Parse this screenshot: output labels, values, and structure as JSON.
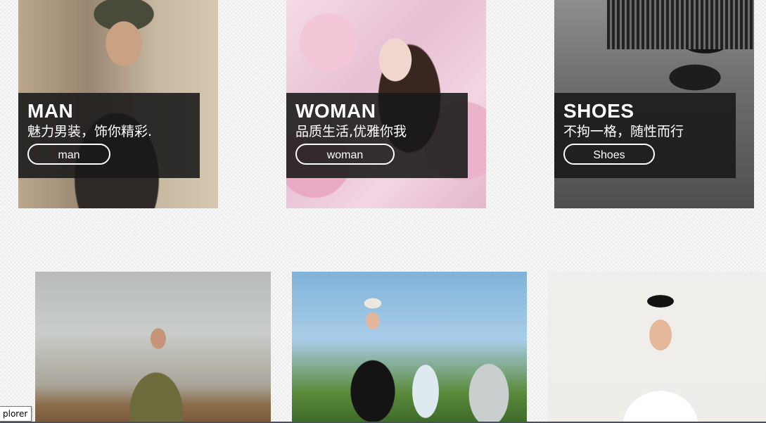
{
  "categories": [
    {
      "title": "MAN",
      "subtitle": "魅力男装，饰你精彩.",
      "button": "man"
    },
    {
      "title": "WOMAN",
      "subtitle": "品质生活,优雅你我",
      "button": "woman"
    },
    {
      "title": "SHOES",
      "subtitle": "不拘一格，随性而行",
      "button": "Shoes"
    }
  ],
  "tooltip": {
    "text": "plorer"
  },
  "colors": {
    "overlay": "#181818",
    "text": "#ffffff"
  }
}
